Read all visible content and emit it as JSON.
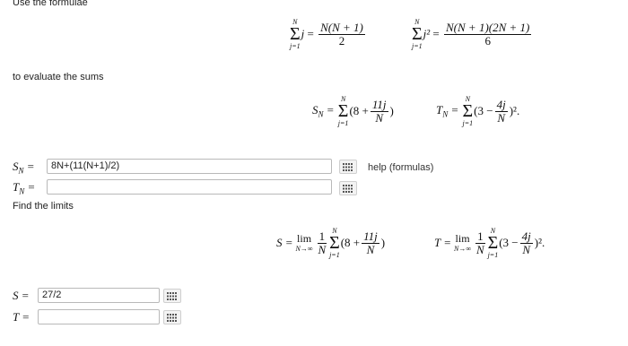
{
  "intro_text": "Use the formulae",
  "evaluate_text": "to evaluate the sums",
  "find_limits_text": "Find the limits",
  "help_link": "help (formulas)",
  "formulas": {
    "sum_sym": "Σ",
    "upper": "N",
    "lower": "j=1",
    "f1_var": "j",
    "f1_num": "N(N + 1)",
    "f1_den": "2",
    "f2_var": "j²",
    "f2_num": "N(N + 1)(2N + 1)",
    "f2_den": "6"
  },
  "sums": {
    "sn_label": "S_N =",
    "sn_open": "(8 +",
    "sn_num": "11j",
    "sn_den": "N",
    "sn_close": ")",
    "tn_label": "T_N =",
    "tn_open": "(3 −",
    "tn_num": "4j",
    "tn_den": "N",
    "tn_close": ")².",
    "s_label": "S =",
    "t_label": "T =",
    "lim_word": "lim",
    "lim_sub": "N→∞",
    "one": "1"
  },
  "inputs": {
    "sn_label": "S_N =",
    "sn_value": "8N+(11(N+1)/2)",
    "tn_label": "T_N =",
    "tn_value": "",
    "s_label": "S =",
    "s_value": "27/2",
    "t_label": "T =",
    "t_value": ""
  },
  "icons": {
    "grid": "matrix-palette-icon"
  }
}
